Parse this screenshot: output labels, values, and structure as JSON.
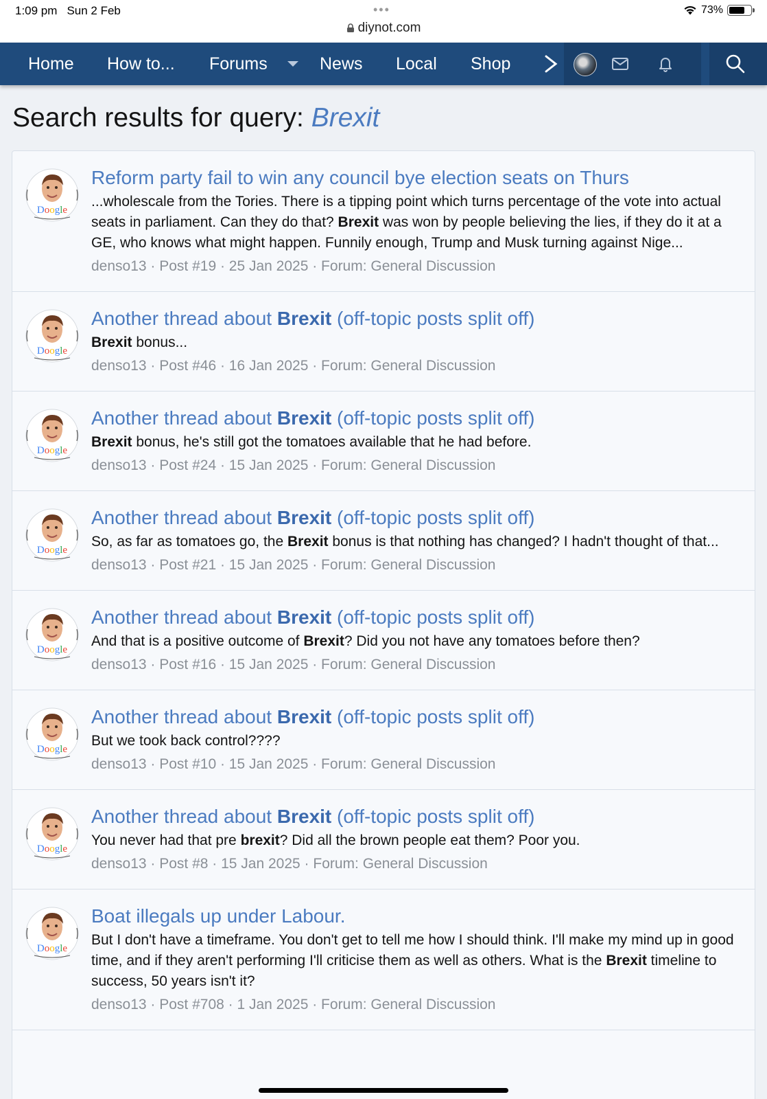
{
  "status_bar": {
    "time": "1:09 pm",
    "date": "Sun 2 Feb",
    "battery": "73%",
    "battery_level": 0.73
  },
  "browser": {
    "url": "diynot.com"
  },
  "nav": {
    "items": [
      "Home",
      "How to...",
      "Forums",
      "News",
      "Local",
      "Shop"
    ],
    "icons": [
      "chevron-right-icon",
      "avatar",
      "envelope-icon",
      "bell-icon",
      "search-icon"
    ]
  },
  "page": {
    "title_prefix": "Search results for query:",
    "query": "Brexit"
  },
  "results": [
    {
      "title": [
        {
          "t": "Reform party fail to win any council bye election seats on Thurs",
          "b": false
        }
      ],
      "snippet": [
        {
          "t": "...wholescale from the Tories. There is a tipping point which turns percentage of the vote into actual seats in parliament. Can they do that? ",
          "b": false
        },
        {
          "t": "Brexit",
          "b": true
        },
        {
          "t": " was won by people believing the lies, if they do it at a GE, who knows what might happen. Funnily enough, Trump and Musk turning against Nige...",
          "b": false
        }
      ],
      "meta": "denso13 · Post #19 · 25 Jan 2025 · Forum: General Discussion"
    },
    {
      "title": [
        {
          "t": "Another thread about ",
          "b": false
        },
        {
          "t": "Brexit",
          "b": true
        },
        {
          "t": " (off-topic posts split off)",
          "b": false
        }
      ],
      "snippet": [
        {
          "t": "Brexit",
          "b": true
        },
        {
          "t": " bonus...",
          "b": false
        }
      ],
      "meta": "denso13 · Post #46 · 16 Jan 2025 · Forum: General Discussion"
    },
    {
      "title": [
        {
          "t": "Another thread about ",
          "b": false
        },
        {
          "t": "Brexit",
          "b": true
        },
        {
          "t": " (off-topic posts split off)",
          "b": false
        }
      ],
      "snippet": [
        {
          "t": "Brexit",
          "b": true
        },
        {
          "t": " bonus, he's still got the tomatoes available that he had before.",
          "b": false
        }
      ],
      "meta": "denso13 · Post #24 · 15 Jan 2025 · Forum: General Discussion"
    },
    {
      "title": [
        {
          "t": "Another thread about ",
          "b": false
        },
        {
          "t": "Brexit",
          "b": true
        },
        {
          "t": " (off-topic posts split off)",
          "b": false
        }
      ],
      "snippet": [
        {
          "t": "So, as far as tomatoes go, the ",
          "b": false
        },
        {
          "t": "Brexit",
          "b": true
        },
        {
          "t": " bonus is that nothing has changed? I hadn't thought of that...",
          "b": false
        }
      ],
      "meta": "denso13 · Post #21 · 15 Jan 2025 · Forum: General Discussion"
    },
    {
      "title": [
        {
          "t": "Another thread about ",
          "b": false
        },
        {
          "t": "Brexit",
          "b": true
        },
        {
          "t": " (off-topic posts split off)",
          "b": false
        }
      ],
      "snippet": [
        {
          "t": "And that is a positive outcome of ",
          "b": false
        },
        {
          "t": "Brexit",
          "b": true
        },
        {
          "t": "? Did you not have any tomatoes before then?",
          "b": false
        }
      ],
      "meta": "denso13 · Post #16 · 15 Jan 2025 · Forum: General Discussion"
    },
    {
      "title": [
        {
          "t": "Another thread about ",
          "b": false
        },
        {
          "t": "Brexit",
          "b": true
        },
        {
          "t": " (off-topic posts split off)",
          "b": false
        }
      ],
      "snippet": [
        {
          "t": "But we took back control????",
          "b": false
        }
      ],
      "meta": "denso13 · Post #10 · 15 Jan 2025 · Forum: General Discussion"
    },
    {
      "title": [
        {
          "t": "Another thread about ",
          "b": false
        },
        {
          "t": "Brexit",
          "b": true
        },
        {
          "t": " (off-topic posts split off)",
          "b": false
        }
      ],
      "snippet": [
        {
          "t": "You never had that pre ",
          "b": false
        },
        {
          "t": "brexit",
          "b": true
        },
        {
          "t": "? Did all the brown people eat them? Poor you.",
          "b": false
        }
      ],
      "meta": "denso13 · Post #8 · 15 Jan 2025 · Forum: General Discussion"
    },
    {
      "title": [
        {
          "t": "Boat illegals up under Labour.",
          "b": false
        }
      ],
      "snippet": [
        {
          "t": "But I don't have a timeframe. You don't get to tell me how I should think. I'll make my mind up in good time, and if they aren't performing I'll criticise them as well as others. What is the ",
          "b": false
        },
        {
          "t": "Brexit",
          "b": true
        },
        {
          "t": " timeline to success, 50 years isn't it?",
          "b": false
        }
      ],
      "meta": "denso13 · Post #708 · 1 Jan 2025 · Forum: General Discussion"
    }
  ],
  "avatar_text": "Doogle",
  "colors": {
    "nav_bg": "#1f4b7c",
    "link": "#4b7bc0",
    "meta": "#8a8f96"
  }
}
